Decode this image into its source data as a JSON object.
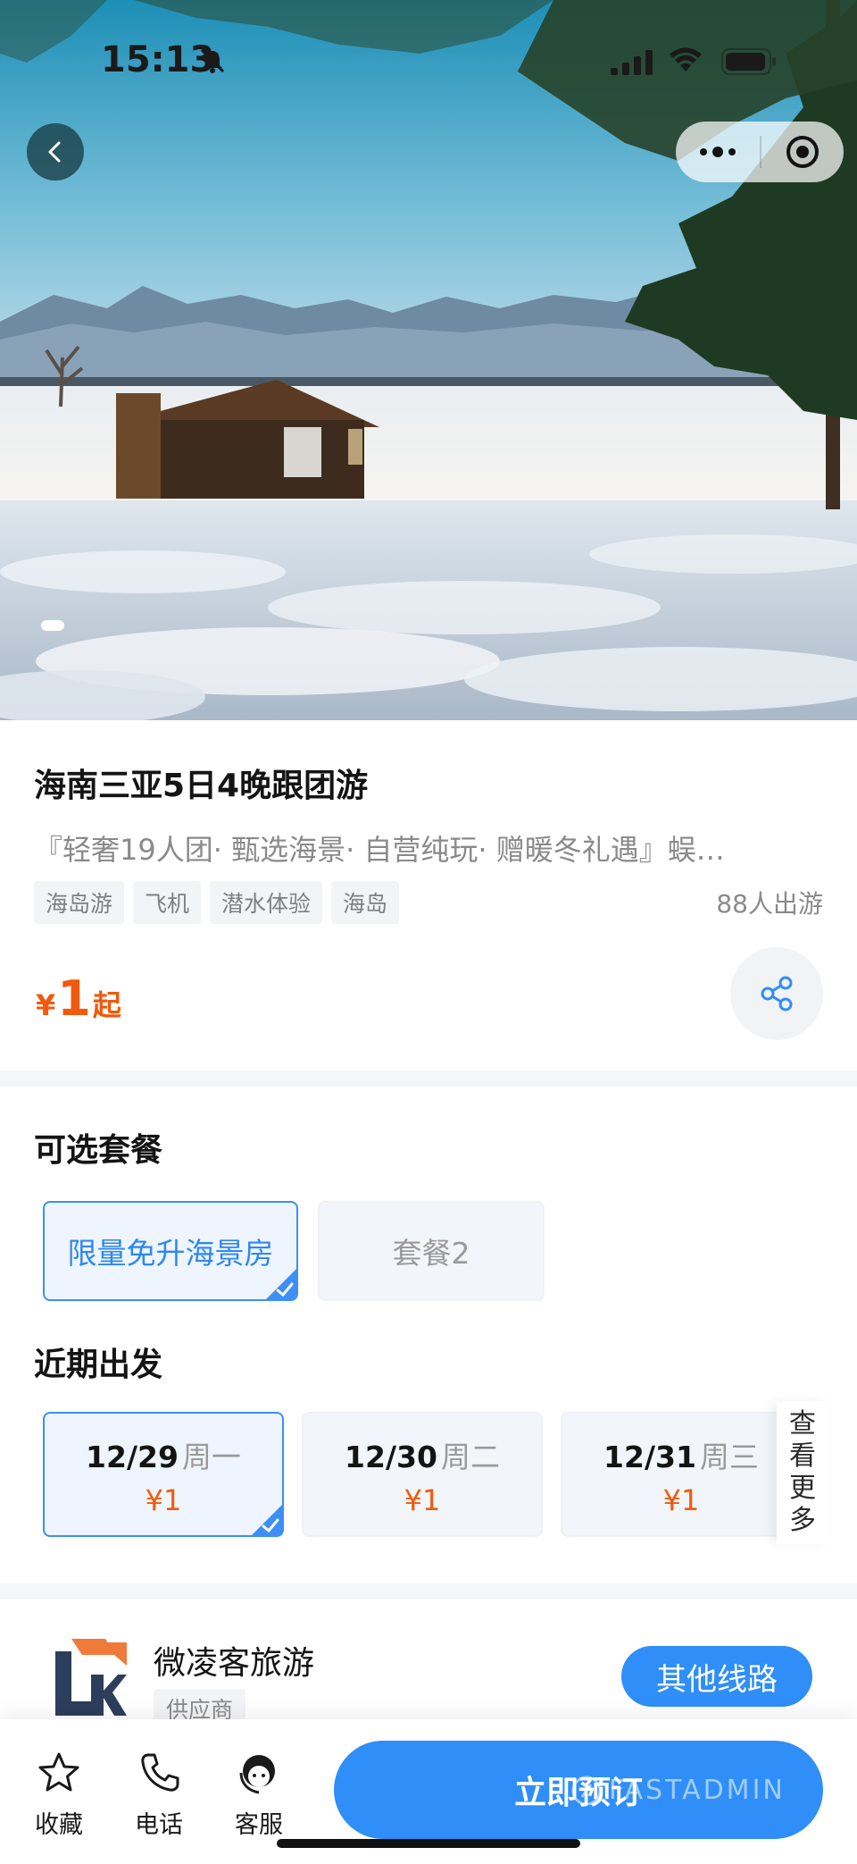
{
  "status_bar": {
    "time": "15:13"
  },
  "product": {
    "title": "海南三亚5日4晚跟团游",
    "subtitle": "『轻奢19人团· 甄选海景· 自营纯玩· 赠暖冬礼遇』蜈…",
    "tags": [
      "海岛游",
      "飞机",
      "潜水体验",
      "海岛"
    ],
    "travelers": "88人出游",
    "price": {
      "currency": "¥",
      "amount": "1",
      "suffix": "起"
    }
  },
  "packages": {
    "title": "可选套餐",
    "items": [
      {
        "label": "限量免升海景房",
        "selected": true
      },
      {
        "label": "套餐2",
        "selected": false
      }
    ]
  },
  "departures": {
    "title": "近期出发",
    "items": [
      {
        "date": "12/29",
        "weekday": "周一",
        "price": "¥1",
        "selected": true
      },
      {
        "date": "12/30",
        "weekday": "周二",
        "price": "¥1",
        "selected": false
      },
      {
        "date": "12/31",
        "weekday": "周三",
        "price": "¥1",
        "selected": false
      }
    ],
    "see_more": [
      "查",
      "看",
      "更",
      "多"
    ]
  },
  "supplier": {
    "name": "微凌客旅游",
    "role": "供应商",
    "other_routes_label": "其他线路"
  },
  "bottom_bar": {
    "favorite_label": "收藏",
    "phone_label": "电话",
    "service_label": "客服",
    "book_label": "立即预订",
    "watermark": "FASTADMIN"
  },
  "colors": {
    "accent_blue": "#2f8ef7",
    "price_orange": "#f05a0e",
    "selected_bg": "#eef5ff",
    "unselected_bg": "#f2f5fa"
  },
  "icons": [
    "back-icon",
    "more-icon",
    "close-target-icon",
    "share-icon",
    "check-icon",
    "star-icon",
    "phone-icon",
    "service-icon"
  ]
}
